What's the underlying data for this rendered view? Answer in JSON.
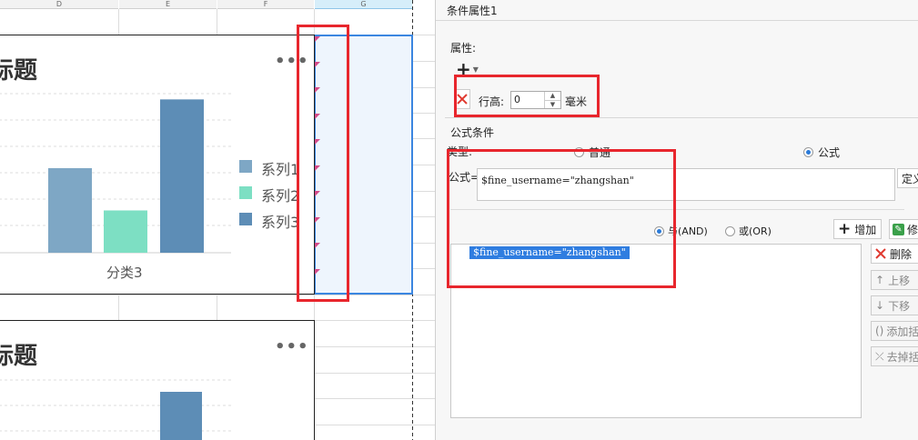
{
  "sheet": {
    "columns": [
      "D",
      "E",
      "F",
      "G"
    ]
  },
  "chart1": {
    "title": "标题",
    "more": "•••",
    "legend": [
      "系列1",
      "系列2",
      "系列3"
    ],
    "category": "分类3"
  },
  "chart2": {
    "title": "标题",
    "more": "•••"
  },
  "chart_data": {
    "type": "bar",
    "categories": [
      "分类3"
    ],
    "series": [
      {
        "name": "系列1",
        "values": [
          3.2
        ],
        "color": "#7ea7c5"
      },
      {
        "name": "系列2",
        "values": [
          1.6
        ],
        "color": "#7ddfc3"
      },
      {
        "name": "系列3",
        "values": [
          5.8
        ],
        "color": "#5d8db6"
      }
    ],
    "ylim": [
      0,
      6.5
    ],
    "title": "标题",
    "xlabel": "",
    "ylabel": ""
  },
  "panel": {
    "title": "条件属性1",
    "properties_label": "属性:",
    "add_symbol": "+",
    "row_height_label": "行高:",
    "row_height_value": "0",
    "unit_label": "毫米",
    "formula_condition_label": "公式条件",
    "type_label": "类型:",
    "type_normal": "普通",
    "type_formula": "公式",
    "formula_label": "公式=",
    "formula_value": "$fine_username=\"zhangshan\"",
    "define_button": "定义",
    "and_label": "与(AND)",
    "or_label": "或(OR)",
    "add_button": "增加",
    "modify_button": "修改",
    "list_items": [
      "$fine_username=\"zhangshan\""
    ],
    "delete_button": "删除",
    "move_up_button": "上移",
    "move_down_button": "下移",
    "add_bracket_button": "添加括号",
    "remove_bracket_button": "去掉括号"
  },
  "colors": {
    "highlight_red": "#e8262d",
    "selection_blue": "#3b86e0",
    "accent_green": "#3aa04a"
  }
}
